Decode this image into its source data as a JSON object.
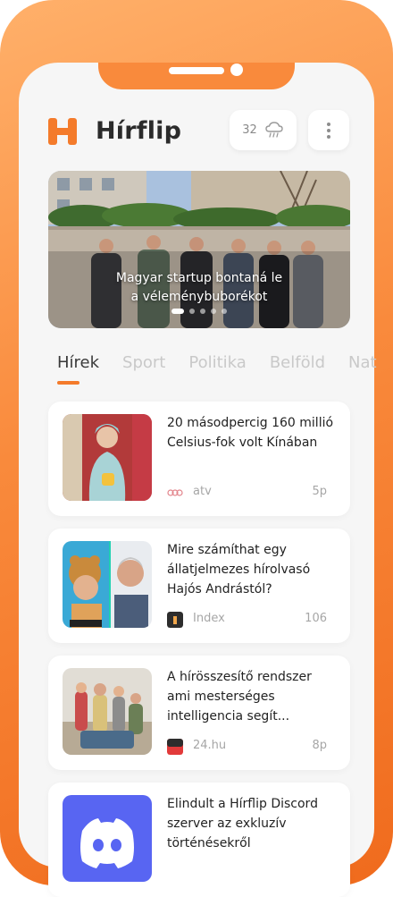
{
  "header": {
    "app_title": "Hírflip",
    "weather_temp": "32"
  },
  "hero": {
    "title_line1": "Magyar startup bontaná le",
    "title_line2": "a véleménybuborékot",
    "slide_count": 5,
    "active_slide": 0
  },
  "tabs": [
    {
      "label": "Hírek",
      "active": true
    },
    {
      "label": "Sport",
      "active": false
    },
    {
      "label": "Politika",
      "active": false
    },
    {
      "label": "Belföld",
      "active": false
    },
    {
      "label": "Nat",
      "active": false
    }
  ],
  "articles": [
    {
      "title": "20 másodpercig 160 millió Celsius-fok volt Kínában",
      "source": "atv",
      "count": "5p"
    },
    {
      "title": "Mire számíthat egy állatjelmezes hírolvasó Hajós Andrástól?",
      "source": "Index",
      "count": "106"
    },
    {
      "title": "A hírösszesítő rendszer ami mesterséges intelligencia segít...",
      "source": "24.hu",
      "count": "8p"
    },
    {
      "title": "Elindult a Hírflip Discord szerver az exkluzív történésekről",
      "source": "",
      "count": ""
    }
  ],
  "colors": {
    "accent": "#f47b2b",
    "frame": "#f98a3c",
    "discord": "#5865f2"
  }
}
